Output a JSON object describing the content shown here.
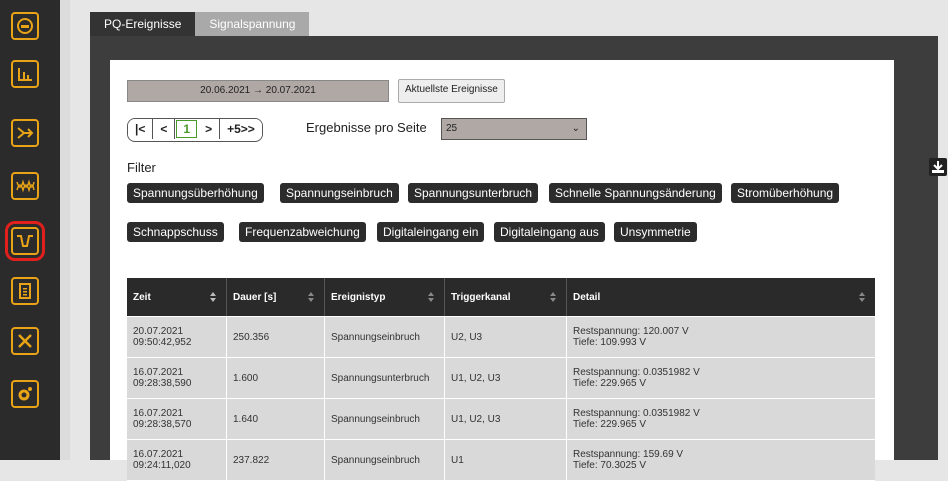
{
  "sidebar": {
    "icons": [
      "meter-icon",
      "bar-chart-icon",
      "flow-icon",
      "waveform-icon",
      "transient-icon",
      "document-icon",
      "tools-icon",
      "settings-icon"
    ]
  },
  "tabs": [
    {
      "label": "PQ-Ereignisse",
      "active": true
    },
    {
      "label": "Signalspannung",
      "active": false
    }
  ],
  "toolbar": {
    "date_range": "20.06.2021 → 20.07.2021",
    "latest_button": "Aktuellste Ereignisse",
    "pager": {
      "first": "|<",
      "prev": "<",
      "current": "1",
      "next": ">",
      "jump": "+5>>"
    },
    "per_page_label": "Ergebnisse pro Seite",
    "per_page_value": "25"
  },
  "filter": {
    "label": "Filter",
    "chips": [
      "Spannungsüberhöhung",
      "Spannungseinbruch",
      "Spannungsunterbruch",
      "Schnelle Spannungsänderung",
      "Stromüberhöhung",
      "Schnappschuss",
      "Frequenzabweichung",
      "Digitaleingang ein",
      "Digitaleingang aus",
      "Unsymmetrie"
    ]
  },
  "table": {
    "headers": [
      "Zeit",
      "Dauer [s]",
      "Ereignistyp",
      "Triggerkanal",
      "Detail"
    ],
    "rows": [
      {
        "date": "20.07.2021",
        "time": "09:50:42,952",
        "dauer": "250.356",
        "typ": "Spannungseinbruch",
        "kanal": "U2, U3",
        "detail1": "Restspannung: 120.007 V",
        "detail2": "Tiefe: 109.993 V"
      },
      {
        "date": "16.07.2021",
        "time": "09:28:38,590",
        "dauer": "1.600",
        "typ": "Spannungsunterbruch",
        "kanal": "U1, U2, U3",
        "detail1": "Restspannung: 0.0351982 V",
        "detail2": "Tiefe: 229.965 V"
      },
      {
        "date": "16.07.2021",
        "time": "09:28:38,570",
        "dauer": "1.640",
        "typ": "Spannungseinbruch",
        "kanal": "U1, U2, U3",
        "detail1": "Restspannung: 0.0351982 V",
        "detail2": "Tiefe: 229.965 V"
      },
      {
        "date": "16.07.2021",
        "time": "09:24:11,020",
        "dauer": "237.822",
        "typ": "Spannungseinbruch",
        "kanal": "U1",
        "detail1": "Restspannung: 159.69 V",
        "detail2": "Tiefe: 70.3025 V"
      }
    ]
  }
}
